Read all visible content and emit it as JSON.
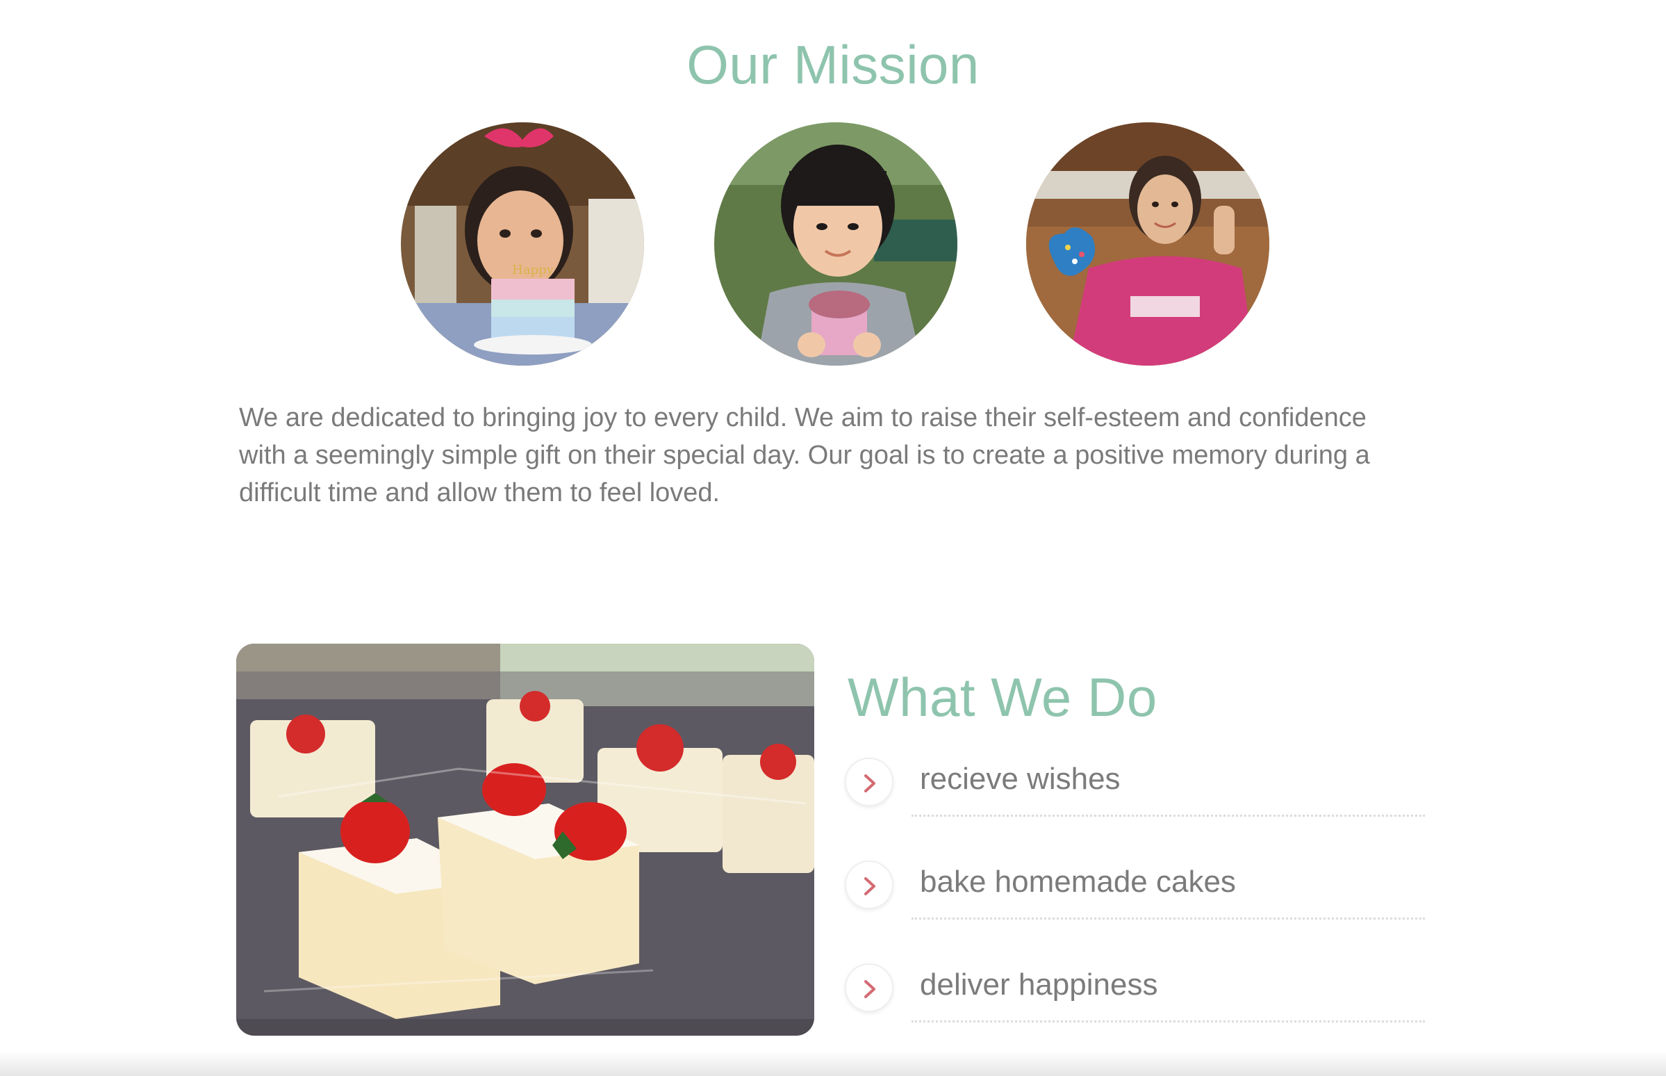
{
  "mission": {
    "title": "Our Mission",
    "photos": [
      {
        "subject": "girl with bow holding small cake"
      },
      {
        "subject": "child holding pink cupcake"
      },
      {
        "subject": "girl in pink shirt holding blue cookie"
      }
    ],
    "text": "We are dedicated to bringing joy to every child. We aim to raise their self-esteem and confidence with a seemingly simple gift on their special day. Our goal is to create a positive memory during a difficult time and allow them to feel loved."
  },
  "what_we_do": {
    "title": "What We Do",
    "image": {
      "subject": "strawberry shortcake slices in plastic containers"
    },
    "items": [
      {
        "label": "recieve wishes",
        "icon": "chevron-right-icon"
      },
      {
        "label": "bake homemade cakes",
        "icon": "chevron-right-icon"
      },
      {
        "label": "deliver happiness",
        "icon": "chevron-right-icon"
      }
    ]
  },
  "colors": {
    "heading": "#8ec4ad",
    "body_text": "#7a7a7a",
    "chevron": "#d46a72"
  }
}
